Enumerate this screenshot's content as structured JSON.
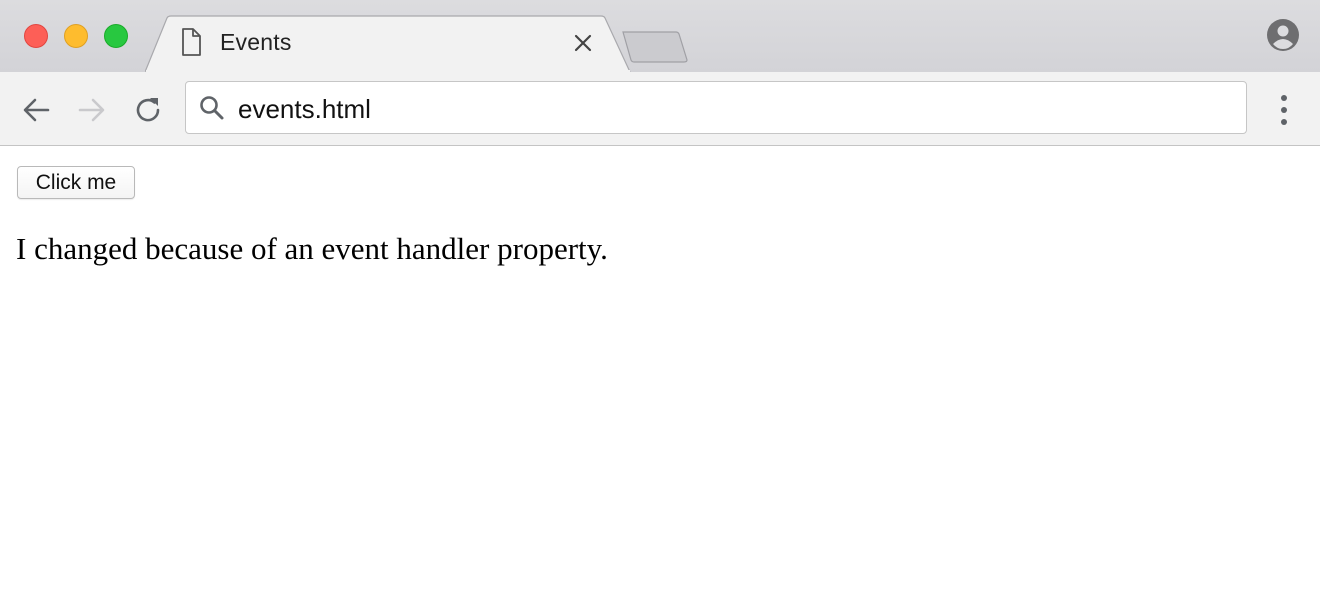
{
  "browser": {
    "tab": {
      "title": "Events",
      "icon": "document-icon",
      "close_icon": "close-icon"
    },
    "new_tab_icon": "new-tab-icon",
    "profile_icon": "account-circle-icon",
    "toolbar": {
      "back_icon": "arrow-left-icon",
      "forward_icon": "arrow-right-icon",
      "reload_icon": "reload-icon",
      "menu_icon": "kebab-menu-icon"
    },
    "address_bar": {
      "icon": "search-icon",
      "value": "events.html"
    },
    "colors": {
      "close": "#fd5f57",
      "minimize": "#febc2e",
      "maximize": "#28c840"
    }
  },
  "page": {
    "button_label": "Click me",
    "paragraph": "I changed because of an event handler property."
  }
}
